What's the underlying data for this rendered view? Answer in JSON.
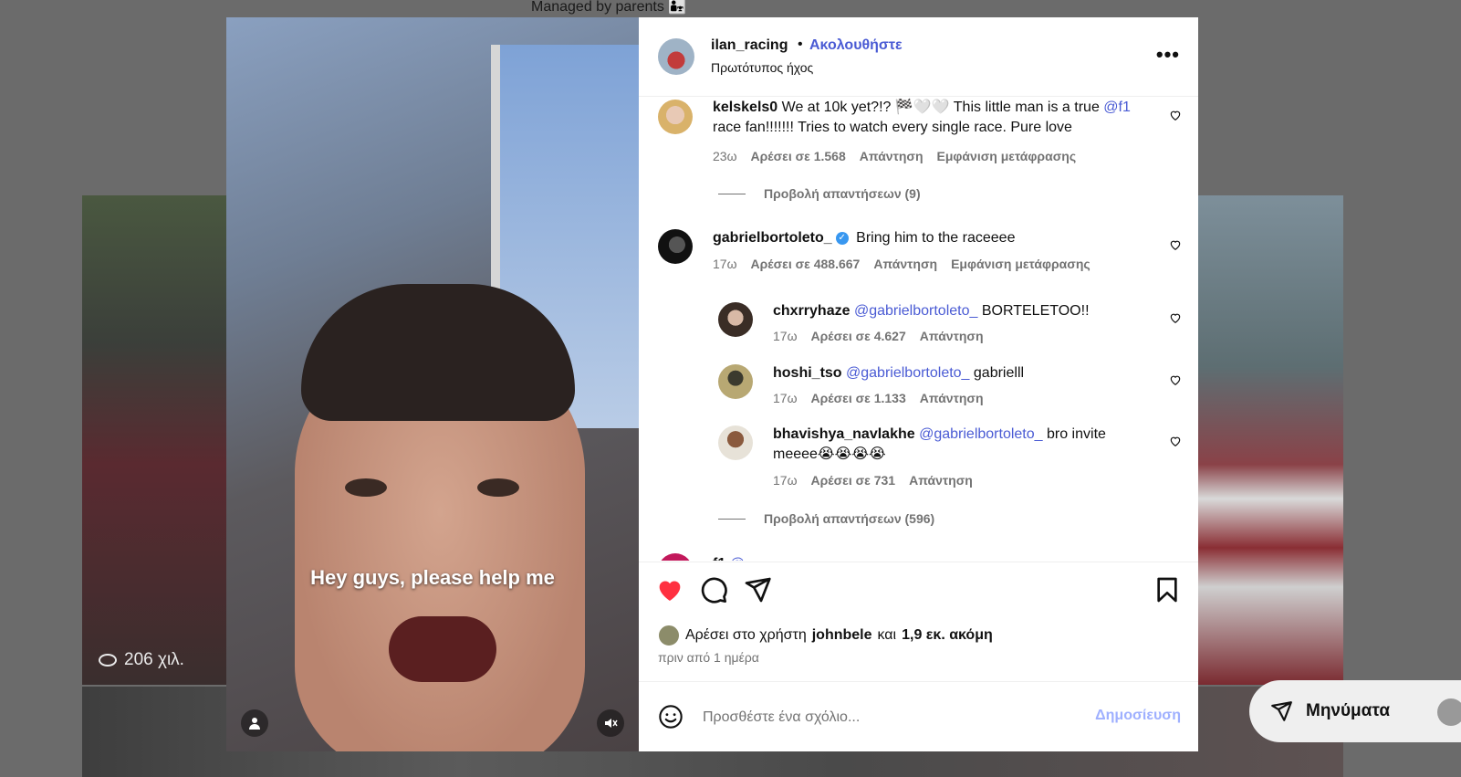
{
  "background": {
    "caption": "Managed by parents 👨‍👧",
    "views": "206 χιλ."
  },
  "media": {
    "subtitle": "Hey guys, please help me"
  },
  "post": {
    "username": "ilan_racing",
    "separator": "•",
    "follow_label": "Ακολουθήστε",
    "audio": "Πρωτότυπος ήχος"
  },
  "comments": [
    {
      "user": "kelskels0",
      "text_a": "We at 10k yet?!? 🏁🤍🤍 This little man is a true",
      "mention": "@f1",
      "text_b": "race fan!!!!!!! Tries to watch every single race. Pure love",
      "time": "23ω",
      "likes": "Αρέσει σε 1.568",
      "reply": "Απάντηση",
      "translate": "Εμφάνιση μετάφρασης",
      "view_replies": "Προβολή απαντήσεων (9)"
    },
    {
      "user": "gabrielbortoleto_",
      "text": "Bring him to the raceeee",
      "time": "17ω",
      "likes": "Αρέσει σε 488.667",
      "reply": "Απάντηση",
      "translate": "Εμφάνιση μετάφρασης",
      "view_replies": "Προβολή απαντήσεων (596)"
    }
  ],
  "replies": [
    {
      "user": "chxrryhaze",
      "mention": "@gabrielbortoleto_",
      "text": "BORTELETOO!!",
      "time": "17ω",
      "likes": "Αρέσει σε 4.627",
      "reply": "Απάντηση"
    },
    {
      "user": "hoshi_tso",
      "mention": "@gabrielbortoleto_",
      "text": "gabrielll",
      "time": "17ω",
      "likes": "Αρέσει σε 1.133",
      "reply": "Απάντηση"
    },
    {
      "user": "bhavishya_navlakhe",
      "mention": "@gabrielbortoleto_",
      "text": "bro invite",
      "text2": "meeee😭😭😭😭",
      "time": "17ω",
      "likes": "Αρέσει σε 731",
      "reply": "Απάντηση"
    }
  ],
  "partial_comment": {
    "user": "f1",
    "text": "@..."
  },
  "likes_summary": {
    "prefix": "Αρέσει στο χρήστη",
    "user": "johnbele",
    "and": "και",
    "others": "1,9 εκ. ακόμη"
  },
  "posted": "πριν από 1 ημέρα",
  "composer": {
    "placeholder": "Προσθέστε ένα σχόλιο...",
    "post_label": "Δημοσίευση"
  },
  "messages": {
    "label": "Μηνύματα"
  },
  "colors": {
    "accent": "#4a5bd4",
    "like_red": "#ff3040",
    "post_disabled": "#9fb0ff"
  }
}
